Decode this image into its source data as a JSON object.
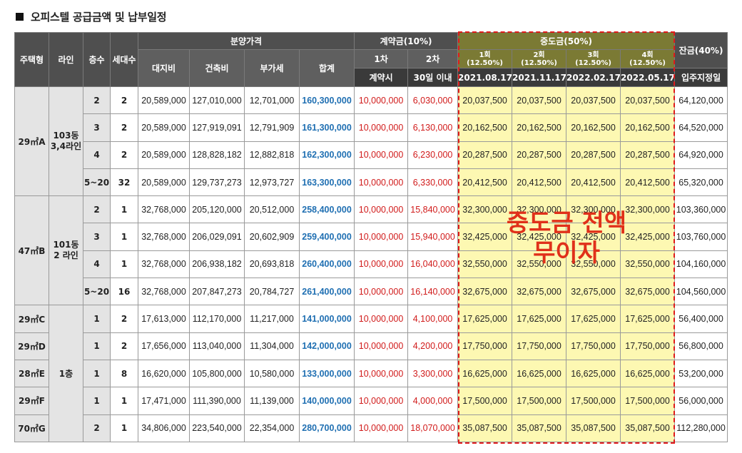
{
  "title": "오피스텔 공급금액 및 납부일정",
  "header": {
    "type": "주택형",
    "line": "라인",
    "floor": "층수",
    "units": "세대수",
    "price_group": "분양가격",
    "land": "대지비",
    "building": "건축비",
    "vat": "부가세",
    "total": "합계",
    "contract_group": "계약금(10%)",
    "c1": "1차",
    "c2": "2차",
    "c1_when": "계약시",
    "c2_when": "30일 이내",
    "middle_group": "중도금(50%)",
    "m": [
      {
        "label": "1회",
        "pct": "(12.50%)",
        "date": "2021.08.17"
      },
      {
        "label": "2회",
        "pct": "(12.50%)",
        "date": "2021.11.17"
      },
      {
        "label": "3회",
        "pct": "(12.50%)",
        "date": "2022.02.17"
      },
      {
        "label": "4회",
        "pct": "(12.50%)",
        "date": "2022.05.17"
      }
    ],
    "balance_group": "잔금(40%)",
    "balance_when": "입주지정일"
  },
  "overlay": {
    "line1": "중도금 전액",
    "line2": "무이자"
  },
  "groups": {
    "g1": {
      "type": "29㎡A",
      "line": "103동 3,4라인"
    },
    "g2": {
      "type": "47㎡B",
      "line": "101동 2 라인"
    },
    "line1": "1층",
    "c": "29㎡C",
    "d": "29㎡D",
    "e": "28㎡E",
    "f": "29㎡F",
    "g": "70㎡G"
  },
  "rows": [
    {
      "floor": "2",
      "units": "2",
      "land": "20,589,000",
      "building": "127,010,000",
      "vat": "12,701,000",
      "total": "160,300,000",
      "c1": "10,000,000",
      "c2": "6,030,000",
      "m1": "20,037,500",
      "m2": "20,037,500",
      "m3": "20,037,500",
      "m4": "20,037,500",
      "bal": "64,120,000"
    },
    {
      "floor": "3",
      "units": "2",
      "land": "20,589,000",
      "building": "127,919,091",
      "vat": "12,791,909",
      "total": "161,300,000",
      "c1": "10,000,000",
      "c2": "6,130,000",
      "m1": "20,162,500",
      "m2": "20,162,500",
      "m3": "20,162,500",
      "m4": "20,162,500",
      "bal": "64,520,000"
    },
    {
      "floor": "4",
      "units": "2",
      "land": "20,589,000",
      "building": "128,828,182",
      "vat": "12,882,818",
      "total": "162,300,000",
      "c1": "10,000,000",
      "c2": "6,230,000",
      "m1": "20,287,500",
      "m2": "20,287,500",
      "m3": "20,287,500",
      "m4": "20,287,500",
      "bal": "64,920,000"
    },
    {
      "floor": "5~20",
      "units": "32",
      "land": "20,589,000",
      "building": "129,737,273",
      "vat": "12,973,727",
      "total": "163,300,000",
      "c1": "10,000,000",
      "c2": "6,330,000",
      "m1": "20,412,500",
      "m2": "20,412,500",
      "m3": "20,412,500",
      "m4": "20,412,500",
      "bal": "65,320,000"
    },
    {
      "floor": "2",
      "units": "1",
      "land": "32,768,000",
      "building": "205,120,000",
      "vat": "20,512,000",
      "total": "258,400,000",
      "c1": "10,000,000",
      "c2": "15,840,000",
      "m1": "32,300,000",
      "m2": "32,300,000",
      "m3": "32,300,000",
      "m4": "32,300,000",
      "bal": "103,360,000"
    },
    {
      "floor": "3",
      "units": "1",
      "land": "32,768,000",
      "building": "206,029,091",
      "vat": "20,602,909",
      "total": "259,400,000",
      "c1": "10,000,000",
      "c2": "15,940,000",
      "m1": "32,425,000",
      "m2": "32,425,000",
      "m3": "32,425,000",
      "m4": "32,425,000",
      "bal": "103,760,000"
    },
    {
      "floor": "4",
      "units": "1",
      "land": "32,768,000",
      "building": "206,938,182",
      "vat": "20,693,818",
      "total": "260,400,000",
      "c1": "10,000,000",
      "c2": "16,040,000",
      "m1": "32,550,000",
      "m2": "32,550,000",
      "m3": "32,550,000",
      "m4": "32,550,000",
      "bal": "104,160,000"
    },
    {
      "floor": "5~20",
      "units": "16",
      "land": "32,768,000",
      "building": "207,847,273",
      "vat": "20,784,727",
      "total": "261,400,000",
      "c1": "10,000,000",
      "c2": "16,140,000",
      "m1": "32,675,000",
      "m2": "32,675,000",
      "m3": "32,675,000",
      "m4": "32,675,000",
      "bal": "104,560,000"
    },
    {
      "floor": "1",
      "units": "2",
      "land": "17,613,000",
      "building": "112,170,000",
      "vat": "11,217,000",
      "total": "141,000,000",
      "c1": "10,000,000",
      "c2": "4,100,000",
      "m1": "17,625,000",
      "m2": "17,625,000",
      "m3": "17,625,000",
      "m4": "17,625,000",
      "bal": "56,400,000"
    },
    {
      "floor": "1",
      "units": "2",
      "land": "17,656,000",
      "building": "113,040,000",
      "vat": "11,304,000",
      "total": "142,000,000",
      "c1": "10,000,000",
      "c2": "4,200,000",
      "m1": "17,750,000",
      "m2": "17,750,000",
      "m3": "17,750,000",
      "m4": "17,750,000",
      "bal": "56,800,000"
    },
    {
      "floor": "1",
      "units": "8",
      "land": "16,620,000",
      "building": "105,800,000",
      "vat": "10,580,000",
      "total": "133,000,000",
      "c1": "10,000,000",
      "c2": "3,300,000",
      "m1": "16,625,000",
      "m2": "16,625,000",
      "m3": "16,625,000",
      "m4": "16,625,000",
      "bal": "53,200,000"
    },
    {
      "floor": "1",
      "units": "1",
      "land": "17,471,000",
      "building": "111,390,000",
      "vat": "11,139,000",
      "total": "140,000,000",
      "c1": "10,000,000",
      "c2": "4,000,000",
      "m1": "17,500,000",
      "m2": "17,500,000",
      "m3": "17,500,000",
      "m4": "17,500,000",
      "bal": "56,000,000"
    },
    {
      "floor": "2",
      "units": "1",
      "land": "34,806,000",
      "building": "223,540,000",
      "vat": "22,354,000",
      "total": "280,700,000",
      "c1": "10,000,000",
      "c2": "18,070,000",
      "m1": "35,087,500",
      "m2": "35,087,500",
      "m3": "35,087,500",
      "m4": "35,087,500",
      "bal": "112,280,000"
    }
  ]
}
